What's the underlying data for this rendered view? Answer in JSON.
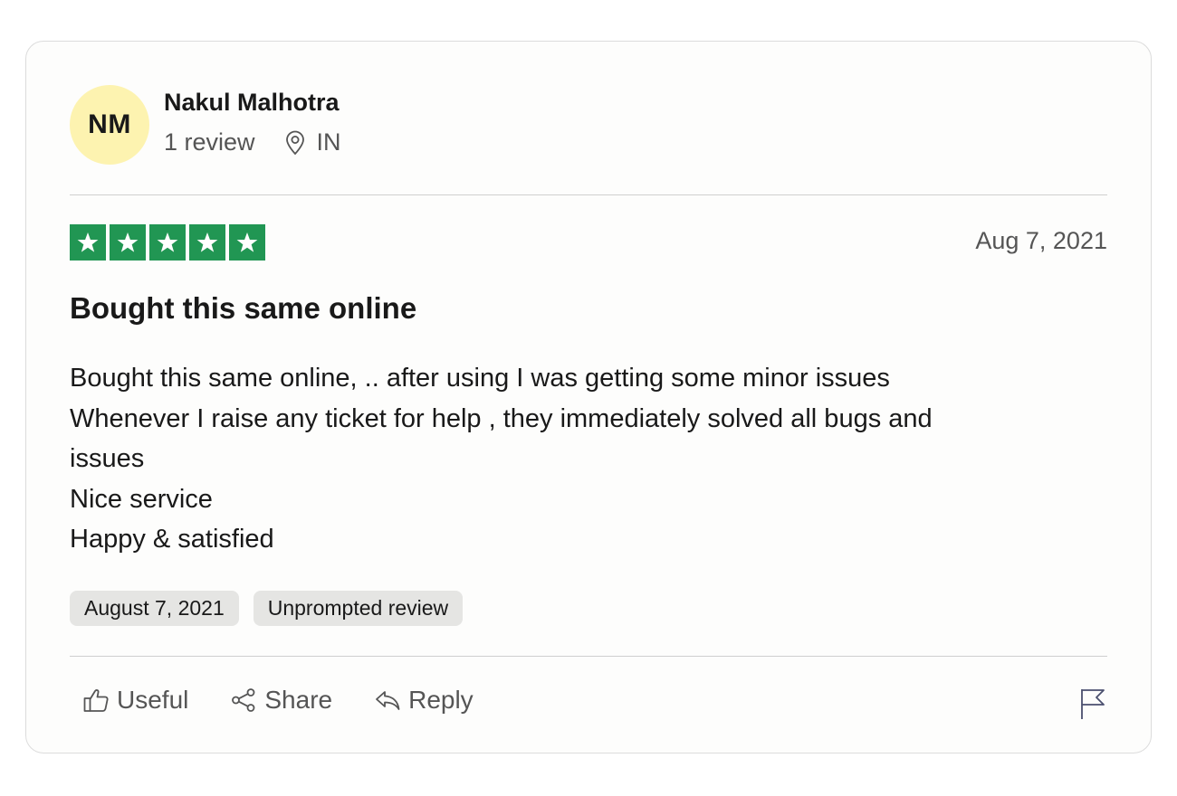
{
  "reviewer": {
    "initials": "NM",
    "name": "Nakul Malhotra",
    "review_count": "1 review",
    "location_icon": "location-pin-icon",
    "country": "IN"
  },
  "rating": {
    "stars": 5,
    "max_stars": 5,
    "star_color": "#219653",
    "date": "Aug 7, 2021"
  },
  "review": {
    "title": "Bought this same online",
    "body_lines": [
      "Bought this same online, .. after using I was getting some minor issues Whenever I raise any ticket for help , they immediately solved all bugs and issues",
      "Nice service",
      "Happy & satisfied"
    ]
  },
  "tags": [
    "August 7, 2021",
    "Unprompted review"
  ],
  "actions": {
    "useful": {
      "label": "Useful",
      "icon": "thumbs-up-icon"
    },
    "share": {
      "label": "Share",
      "icon": "share-icon"
    },
    "reply": {
      "label": "Reply",
      "icon": "reply-icon"
    },
    "flag": {
      "icon": "flag-icon"
    }
  },
  "colors": {
    "avatar_bg": "#fdf3b0",
    "star_bg": "#219653",
    "tag_bg": "#e5e5e3"
  }
}
